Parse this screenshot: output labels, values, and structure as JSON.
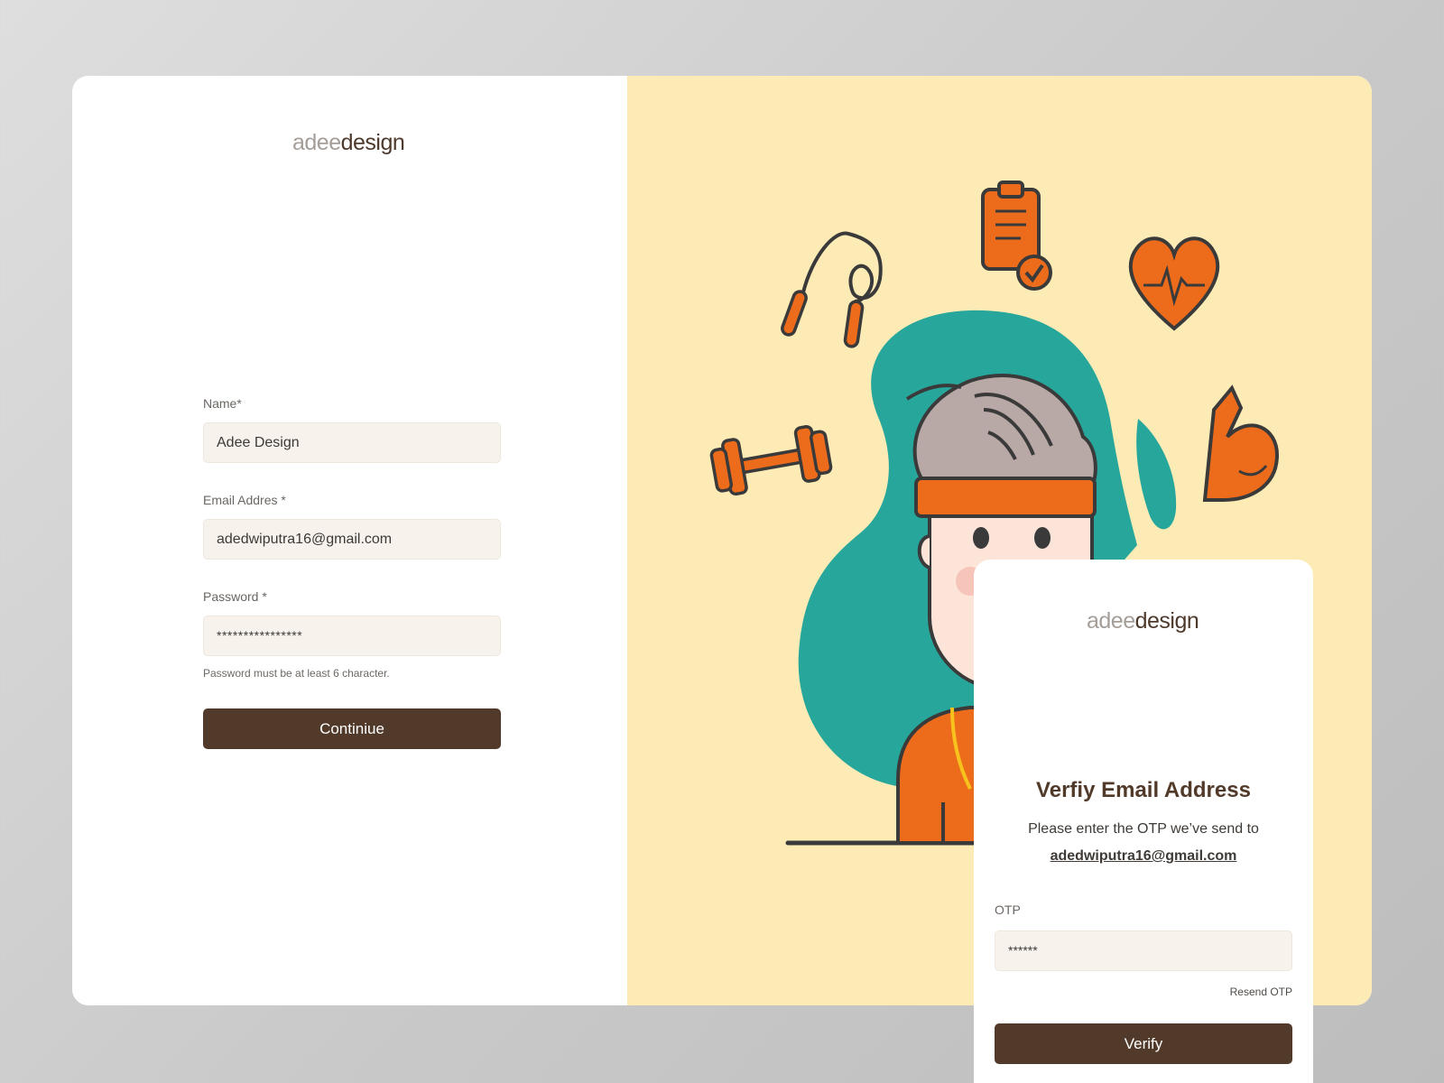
{
  "brand": {
    "logo_light": "adee",
    "logo_dark": "design"
  },
  "signup_form": {
    "name_label": "Name*",
    "name_value": "Adee Design",
    "email_label": "Email Addres *",
    "email_value": "adedwiputra16@gmail.com",
    "password_label": "Password  *",
    "password_value": "****************",
    "password_hint": "Password  must be at least 6 character.",
    "continue_label": "Continiue"
  },
  "verify_card": {
    "title": "Verfiy Email Address",
    "description": "Please enter the OTP we’ve send to",
    "email": "adedwiputra16@gmail.com",
    "otp_label": "OTP",
    "otp_value": "******",
    "resend_label": "Resend OTP",
    "verify_label": "Verify"
  },
  "colors": {
    "accent_brown": "#523a2a",
    "illustration_bg": "#fdebb6",
    "teal": "#27a79c",
    "orange": "#ec6c1c",
    "input_bg": "#f7f2eb"
  },
  "illustration": {
    "icons": [
      "jump-rope-icon",
      "clipboard-check-icon",
      "heart-pulse-icon",
      "dumbbell-icon",
      "flexed-arm-icon"
    ]
  }
}
